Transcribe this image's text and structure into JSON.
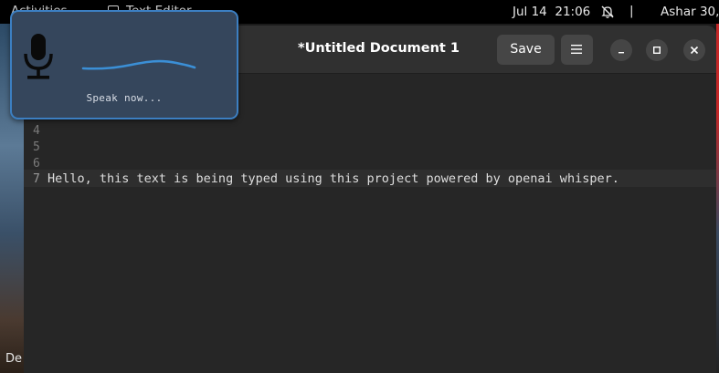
{
  "topbar": {
    "activities": "Activities",
    "app_name": "Text Editor",
    "date": "Jul 14",
    "time": "21:06",
    "separator": "|",
    "user": "Ashar 30,"
  },
  "desktop": {
    "left_edge_label": "De"
  },
  "window": {
    "title": "*Untitled Document 1",
    "save_label": "Save",
    "menu_icon": "hamburger-menu-icon",
    "minimize_icon": "minimize-icon",
    "maximize_icon": "maximize-icon",
    "close_icon": "close-icon"
  },
  "editor": {
    "line_numbers": [
      "4",
      "5",
      "6",
      "7"
    ],
    "current_line_number": "7",
    "current_line_text": "Hello, this text is being typed using this project powered by openai whisper."
  },
  "voice_popup": {
    "prompt": "Speak now...",
    "mic_icon": "microphone-icon",
    "waveform": "audio-waveform"
  },
  "colors": {
    "popup_bg": "#35465c",
    "popup_border": "#3c7fc2",
    "waveform": "#3b8fd6",
    "editor_bg": "#262626",
    "headerbar_bg": "#303030"
  }
}
